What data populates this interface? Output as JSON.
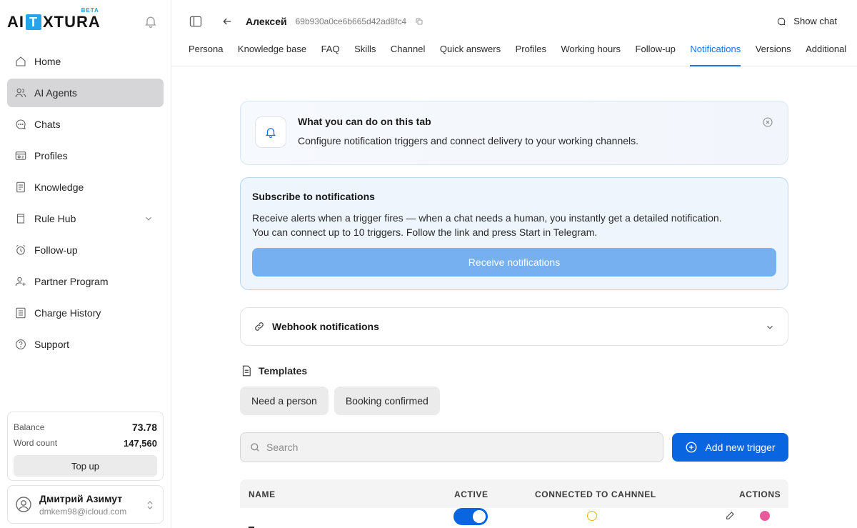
{
  "brand": {
    "logo_text_left": "AI",
    "logo_box": "T",
    "logo_text_right": "XTURA",
    "beta": "BETA"
  },
  "sidebar": {
    "items": [
      {
        "label": "Home",
        "icon": "home-icon"
      },
      {
        "label": "AI Agents",
        "icon": "users-icon",
        "active": true
      },
      {
        "label": "Chats",
        "icon": "chat-icon"
      },
      {
        "label": "Profiles",
        "icon": "id-card-icon"
      },
      {
        "label": "Knowledge",
        "icon": "book-icon"
      },
      {
        "label": "Rule Hub",
        "icon": "rulebook-icon",
        "expandable": true
      },
      {
        "label": "Follow-up",
        "icon": "alarm-clock-icon"
      },
      {
        "label": "Partner Program",
        "icon": "user-plus-icon"
      },
      {
        "label": "Charge History",
        "icon": "list-icon"
      },
      {
        "label": "Support",
        "icon": "help-icon"
      }
    ]
  },
  "balance": {
    "balance_label": "Balance",
    "balance_value": "73.78",
    "words_label": "Word count",
    "words_value": "147,560",
    "topup_label": "Top up"
  },
  "user": {
    "name": "Дмитрий Азимут",
    "email": "dmkem98@icloud.com"
  },
  "header": {
    "agent_name": "Алексей",
    "agent_id": "69b930a0ce6b665d42ad8fc4",
    "show_chat": "Show chat"
  },
  "tabs": [
    {
      "label": "Persona"
    },
    {
      "label": "Knowledge base"
    },
    {
      "label": "FAQ"
    },
    {
      "label": "Skills"
    },
    {
      "label": "Channel"
    },
    {
      "label": "Quick answers"
    },
    {
      "label": "Profiles"
    },
    {
      "label": "Working hours"
    },
    {
      "label": "Follow-up"
    },
    {
      "label": "Notifications",
      "active": true
    },
    {
      "label": "Versions"
    },
    {
      "label": "Additional"
    }
  ],
  "info": {
    "title": "What you can do on this tab",
    "desc": "Configure notification triggers and connect delivery to your working channels."
  },
  "subscribe": {
    "title": "Subscribe to notifications",
    "line1": "Receive alerts when a trigger fires — when a chat needs a human, you instantly get a detailed notification.",
    "line2": "You can connect up to 10 triggers. Follow the link and press Start in Telegram.",
    "button": "Receive notifications"
  },
  "webhook": {
    "title": "Webhook notifications"
  },
  "templates": {
    "title": "Templates",
    "chips": [
      "Need a person",
      "Booking confirmed"
    ]
  },
  "search": {
    "placeholder": "Search"
  },
  "add_trigger": "Add new trigger",
  "table": {
    "headers": {
      "name": "NAME",
      "active": "ACTIVE",
      "channel": "CONNECTED TO CAHNNEL",
      "actions": "ACTIONS"
    }
  },
  "colors": {
    "accent": "#0a66e0",
    "active_tab": "#1a73e8",
    "active_nav_bg": "#d6d5d8",
    "receive_btn": "#76b0f1"
  }
}
